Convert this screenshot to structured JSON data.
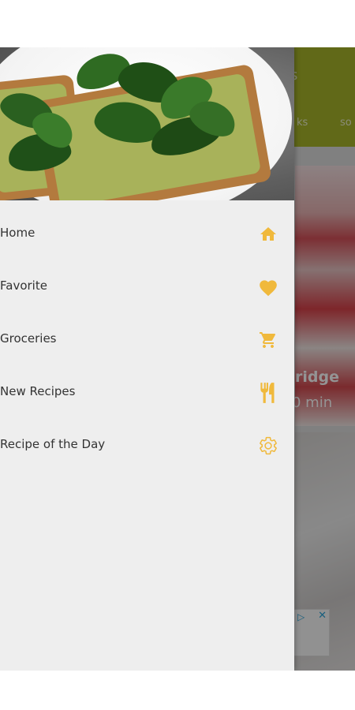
{
  "drawer": {
    "items": [
      {
        "label": "Home",
        "icon": "home-icon"
      },
      {
        "label": "Favorite",
        "icon": "heart-icon"
      },
      {
        "label": "Groceries",
        "icon": "cart-icon"
      },
      {
        "label": "New Recipes",
        "icon": "fork-knife-icon"
      },
      {
        "label": "Recipe of the Day",
        "icon": "gear-icon"
      }
    ],
    "accent": "#f0b93c"
  },
  "background_app": {
    "header_color": "#a7b52a",
    "header_fragment": "s",
    "tabs": [
      "ks",
      "so"
    ],
    "card_title": "ridge",
    "card_time": "0 min"
  }
}
